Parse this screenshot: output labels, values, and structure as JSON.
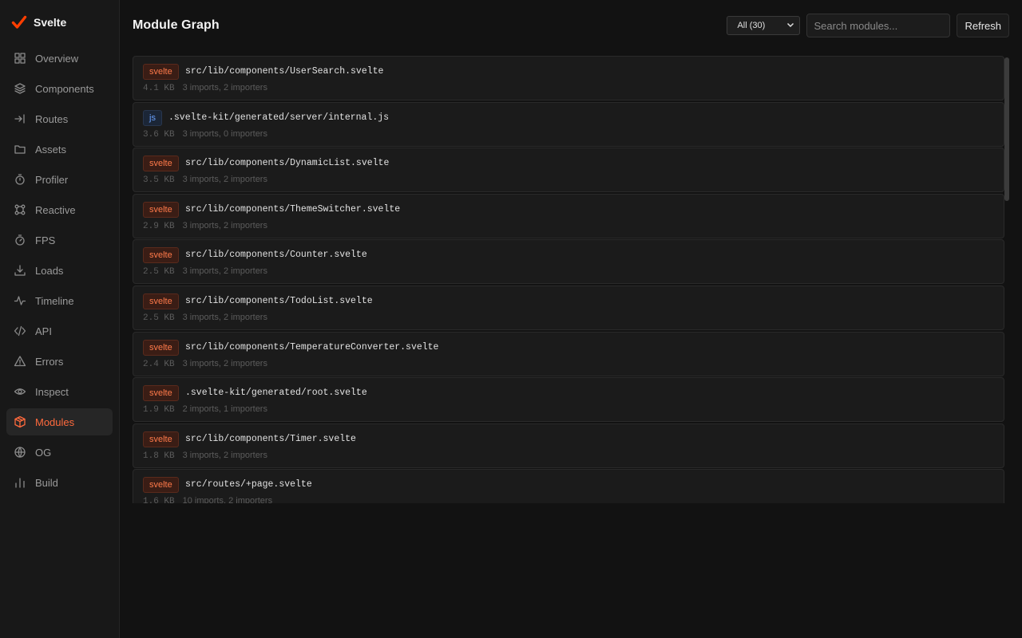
{
  "brand": {
    "name": "Svelte",
    "icon": "svelte-check-logo",
    "accent": "#ff3e00"
  },
  "sidebar": {
    "items": [
      {
        "label": "Overview",
        "icon": "grid-icon",
        "active": false
      },
      {
        "label": "Components",
        "icon": "layers-icon",
        "active": false
      },
      {
        "label": "Routes",
        "icon": "arrow-right-to-line-icon",
        "active": false
      },
      {
        "label": "Assets",
        "icon": "folder-icon",
        "active": false
      },
      {
        "label": "Profiler",
        "icon": "stopwatch-icon",
        "active": false
      },
      {
        "label": "Reactive",
        "icon": "nodes-icon",
        "active": false
      },
      {
        "label": "FPS",
        "icon": "timer-icon",
        "active": false
      },
      {
        "label": "Loads",
        "icon": "download-icon",
        "active": false
      },
      {
        "label": "Timeline",
        "icon": "activity-icon",
        "active": false
      },
      {
        "label": "API",
        "icon": "code-icon",
        "active": false
      },
      {
        "label": "Errors",
        "icon": "warning-icon",
        "active": false
      },
      {
        "label": "Inspect",
        "icon": "eye-icon",
        "active": false
      },
      {
        "label": "Modules",
        "icon": "package-icon",
        "active": true
      },
      {
        "label": "OG",
        "icon": "globe-icon",
        "active": false
      },
      {
        "label": "Build",
        "icon": "bar-chart-icon",
        "active": false
      }
    ]
  },
  "header": {
    "title": "Module Graph",
    "filter_value": "All (30)",
    "search_placeholder": "Search modules...",
    "refresh_label": "Refresh"
  },
  "modules": [
    {
      "type": "svelte",
      "path": "src/lib/components/UserSearch.svelte",
      "size": "4.1 KB",
      "stats": "3 imports, 2 importers"
    },
    {
      "type": "js",
      "path": ".svelte-kit/generated/server/internal.js",
      "size": "3.6 KB",
      "stats": "3 imports, 0 importers"
    },
    {
      "type": "svelte",
      "path": "src/lib/components/DynamicList.svelte",
      "size": "3.5 KB",
      "stats": "3 imports, 2 importers"
    },
    {
      "type": "svelte",
      "path": "src/lib/components/ThemeSwitcher.svelte",
      "size": "2.9 KB",
      "stats": "3 imports, 2 importers"
    },
    {
      "type": "svelte",
      "path": "src/lib/components/Counter.svelte",
      "size": "2.5 KB",
      "stats": "3 imports, 2 importers"
    },
    {
      "type": "svelte",
      "path": "src/lib/components/TodoList.svelte",
      "size": "2.5 KB",
      "stats": "3 imports, 2 importers"
    },
    {
      "type": "svelte",
      "path": "src/lib/components/TemperatureConverter.svelte",
      "size": "2.4 KB",
      "stats": "3 imports, 2 importers"
    },
    {
      "type": "svelte",
      "path": ".svelte-kit/generated/root.svelte",
      "size": "1.9 KB",
      "stats": "2 imports, 1 importers"
    },
    {
      "type": "svelte",
      "path": "src/lib/components/Timer.svelte",
      "size": "1.8 KB",
      "stats": "3 imports, 2 importers"
    },
    {
      "type": "svelte",
      "path": "src/routes/+page.svelte",
      "size": "1.6 KB",
      "stats": "10 imports, 2 importers"
    }
  ]
}
